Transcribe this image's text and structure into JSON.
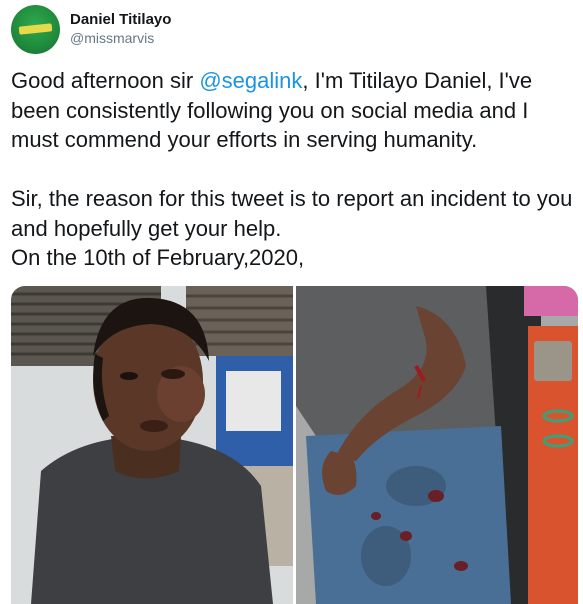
{
  "user": {
    "display_name": "Daniel Titilayo",
    "handle": "@missmarvis",
    "avatar_icon": "green-logo-avatar"
  },
  "tweet": {
    "mention": "@segalink",
    "text_before_mention": "Good afternoon sir ",
    "text_after_mention": ", I'm Titilayo Daniel, I've been consistently following you on social media and I must commend your efforts in serving humanity.\n\nSir, the reason for this tweet is to report an incident to you and hopefully get your help.\nOn the 10th of February,2020,"
  },
  "media": {
    "photos": [
      {
        "name": "photo-injured-face",
        "description_icon": "face-photo"
      },
      {
        "name": "photo-injured-arm",
        "description_icon": "arm-photo"
      }
    ]
  },
  "colors": {
    "link": "#1b95e0",
    "text": "#14171a",
    "handle": "#657786",
    "avatar_green": "#1f8a3c"
  }
}
